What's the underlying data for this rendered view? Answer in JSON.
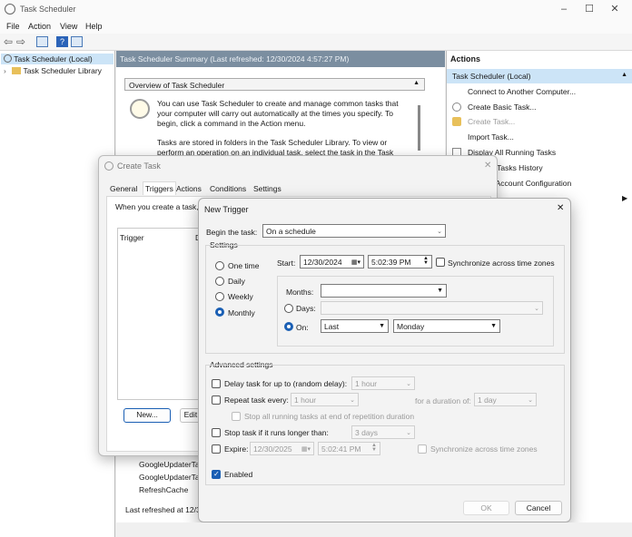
{
  "window": {
    "title": "Task Scheduler"
  },
  "menu": [
    "File",
    "Action",
    "View",
    "Help"
  ],
  "tree": {
    "root": "Task Scheduler (Local)",
    "library": "Task Scheduler Library"
  },
  "center": {
    "header": "Task Scheduler Summary (Last refreshed: 12/30/2024 4:57:27 PM)",
    "overview_title": "Overview of Task Scheduler",
    "overview_text1": "You can use Task Scheduler to create and manage common tasks that your computer will carry out automatically at the times you specify. To begin, click a command in the Action menu.",
    "overview_text2": "Tasks are stored in folders in the Task Scheduler Library. To view or perform an operation on an individual task, select the task in the Task",
    "tasks": [
      "GoogleUpdaterTa",
      "GoogleUpdaterTa",
      "RefreshCache"
    ],
    "last_refreshed": "Last refreshed at 12/30"
  },
  "actions": {
    "header": "Actions",
    "group": "Task Scheduler (Local)",
    "items": [
      "Connect to Another Computer...",
      "Create Basic Task...",
      "Create Task...",
      "Import Task...",
      "Display All Running Tasks",
      "l Tasks History",
      "e Account Configuration"
    ]
  },
  "create_task": {
    "title": "Create Task",
    "tabs": [
      "General",
      "Triggers",
      "Actions",
      "Conditions",
      "Settings"
    ],
    "intro": "When you create a task, y",
    "col_trigger": "Trigger",
    "col_d": "D",
    "new_btn": "New...",
    "edit_btn": "Edit..."
  },
  "new_trigger": {
    "title": "New Trigger",
    "begin_label": "Begin the task:",
    "begin_value": "On a schedule",
    "settings_label": "Settings",
    "schedule_options": [
      "One time",
      "Daily",
      "Weekly",
      "Monthly"
    ],
    "start_label": "Start:",
    "start_date": "12/30/2024",
    "start_time": "5:02:39 PM",
    "sync_label": "Synchronize across time zones",
    "months_label": "Months:",
    "days_label": "Days:",
    "on_label": "On:",
    "on_which": "Last",
    "on_day": "Monday",
    "advanced_label": "Advanced settings",
    "delay_label": "Delay task for up to (random delay):",
    "delay_value": "1 hour",
    "repeat_label": "Repeat task every:",
    "repeat_value": "1 hour",
    "duration_label": "for a duration of:",
    "duration_value": "1 day",
    "stop_running_label": "Stop all running tasks at end of repetition duration",
    "stop_if_label": "Stop task if it runs longer than:",
    "stop_if_value": "3 days",
    "expire_label": "Expire:",
    "expire_date": "12/30/2025",
    "expire_time": "5:02:41 PM",
    "expire_sync_label": "Synchronize across time zones",
    "enabled_label": "Enabled",
    "ok": "OK",
    "cancel": "Cancel"
  },
  "colors": {
    "accent": "#1a5fb4",
    "header_bar": "#7b8ea0",
    "selection": "#cce4f7"
  }
}
